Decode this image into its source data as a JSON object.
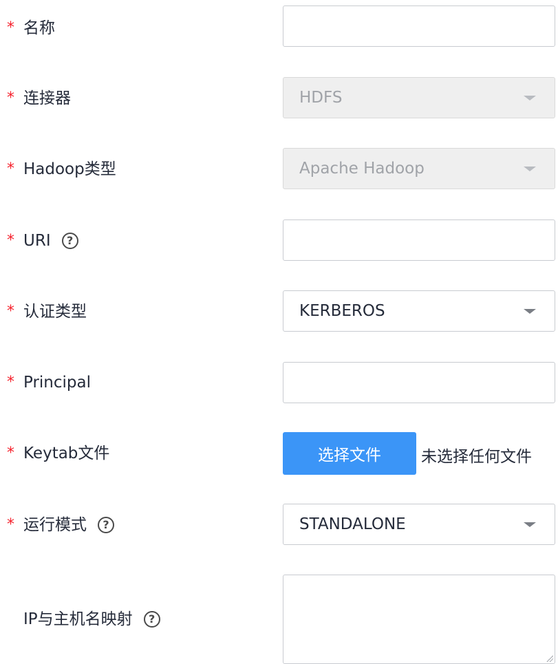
{
  "form": {
    "required_mark": "*",
    "help_glyph": "?",
    "name": {
      "label": "名称",
      "value": ""
    },
    "connector": {
      "label": "连接器",
      "value": "HDFS"
    },
    "hadoop_type": {
      "label": "Hadoop类型",
      "value": "Apache Hadoop"
    },
    "uri": {
      "label": "URI",
      "value": ""
    },
    "auth_type": {
      "label": "认证类型",
      "value": "KERBEROS"
    },
    "principal": {
      "label": "Principal",
      "value": ""
    },
    "keytab": {
      "label": "Keytab文件",
      "button_label": "选择文件",
      "status": "未选择任何文件"
    },
    "run_mode": {
      "label": "运行模式",
      "value": "STANDALONE"
    },
    "ip_mapping": {
      "label": "IP与主机名映射",
      "value": ""
    }
  },
  "colors": {
    "required": "#f5222d",
    "primary_button": "#3b95f7",
    "disabled_bg": "#efefef",
    "border": "#c8cbd0"
  },
  "icons": {
    "help": "question-circle-icon",
    "dropdown": "caret-down-icon"
  }
}
